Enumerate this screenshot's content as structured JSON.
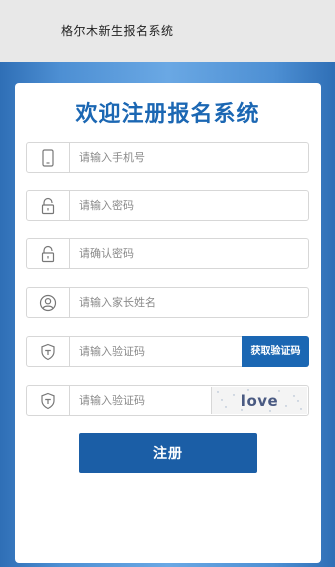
{
  "header": {
    "title": "格尔木新生报名系统"
  },
  "form": {
    "title": "欢迎注册报名系统",
    "fields": [
      {
        "icon": "phone-icon",
        "placeholder": "请输入手机号"
      },
      {
        "icon": "lock-icon",
        "placeholder": "请输入密码"
      },
      {
        "icon": "lock-icon",
        "placeholder": "请确认密码"
      },
      {
        "icon": "user-icon",
        "placeholder": "请输入家长姓名"
      },
      {
        "icon": "shield-icon",
        "placeholder": "请输入验证码"
      },
      {
        "icon": "shield-icon",
        "placeholder": "请输入验证码"
      }
    ],
    "get_code_label": "获取验证码",
    "captcha_text": "love",
    "submit_label": "注册"
  },
  "colors": {
    "brand": "#1b67b3",
    "button": "#1b5ea6"
  }
}
